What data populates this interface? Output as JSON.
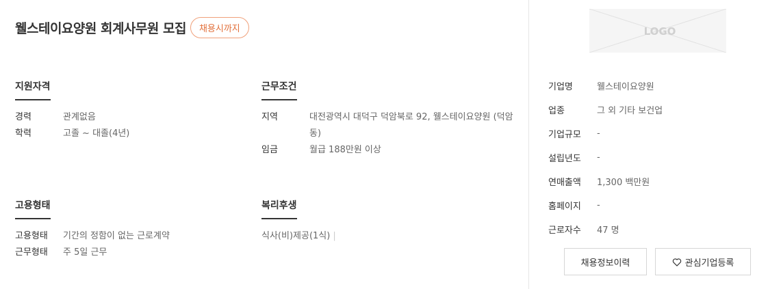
{
  "header": {
    "title": "웰스테이요양원 회계사무원 모집",
    "deadline_badge": "채용시까지"
  },
  "qualifications": {
    "title": "지원자격",
    "rows": [
      {
        "label": "경력",
        "value": "관계없음"
      },
      {
        "label": "학력",
        "value": "고졸 ~ 대졸(4년)"
      }
    ]
  },
  "conditions": {
    "title": "근무조건",
    "rows": [
      {
        "label": "지역",
        "value": "대전광역시 대덕구 덕암북로 92, 웰스테이요양원 (덕암동)"
      },
      {
        "label": "임금",
        "value": "월급 188만원 이상"
      }
    ]
  },
  "employment": {
    "title": "고용형태",
    "rows": [
      {
        "label": "고용형태",
        "value": "기간의 정함이 없는 근로계약"
      },
      {
        "label": "근무형태",
        "value": "주 5일 근무"
      }
    ]
  },
  "welfare": {
    "title": "복리후생",
    "items_text": "식사(비)제공(1식)",
    "separator": "|"
  },
  "company": {
    "logo_text": "LOGO",
    "rows": [
      {
        "label": "기업명",
        "value": "웰스테이요양원"
      },
      {
        "label": "업종",
        "value": "그 외 기타 보건업"
      },
      {
        "label": "기업규모",
        "value": "-"
      },
      {
        "label": "설립년도",
        "value": "-"
      },
      {
        "label": "연매출액",
        "value": "1,300 백만원"
      },
      {
        "label": "홈페이지",
        "value": "-"
      },
      {
        "label": "근로자수",
        "value": "47 명"
      }
    ]
  },
  "buttons": {
    "history": "채용정보이력",
    "interest": "관심기업등록"
  },
  "icons": {
    "interest": "heart-outline-icon"
  },
  "colors": {
    "accent": "#e2703b",
    "badge_border": "#f0a07a",
    "divider": "#e6e6e6"
  }
}
